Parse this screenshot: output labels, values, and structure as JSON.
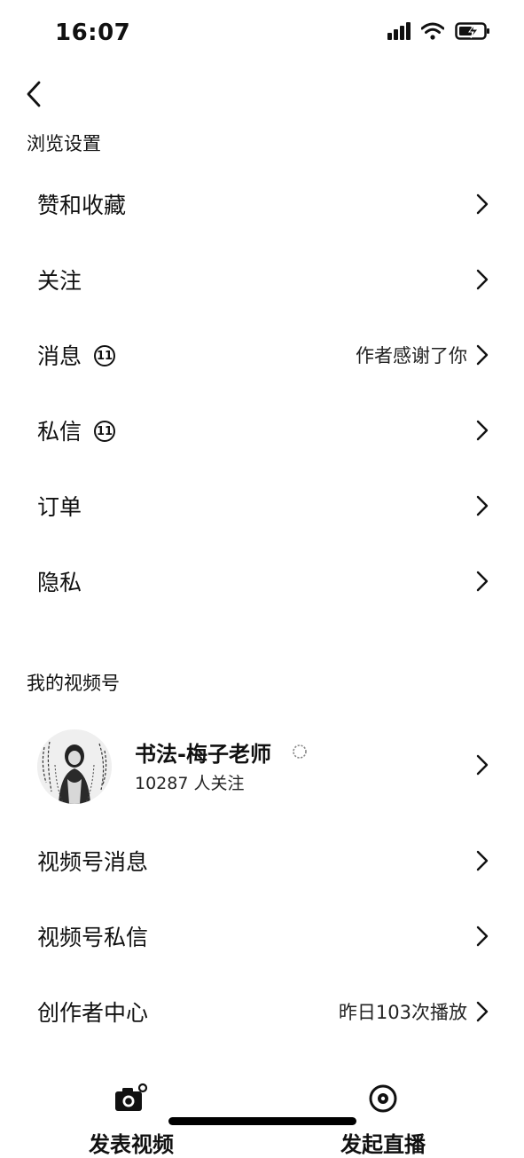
{
  "status_bar": {
    "time": "16:07"
  },
  "sections": {
    "browse_title": "浏览设置",
    "channel_title": "我的视频号"
  },
  "browse_items": [
    {
      "label": "赞和收藏",
      "right_text": "",
      "badge": ""
    },
    {
      "label": "关注",
      "right_text": "",
      "badge": ""
    },
    {
      "label": "消息",
      "right_text": "作者感谢了你",
      "badge": "11"
    },
    {
      "label": "私信",
      "right_text": "",
      "badge": "11"
    },
    {
      "label": "订单",
      "right_text": "",
      "badge": ""
    },
    {
      "label": "隐私",
      "right_text": "",
      "badge": ""
    }
  ],
  "profile": {
    "name": "书法-梅子老师",
    "followers": "10287 人关注"
  },
  "channel_items": [
    {
      "label": "视频号消息",
      "right_text": ""
    },
    {
      "label": "视频号私信",
      "right_text": ""
    },
    {
      "label": "创作者中心",
      "right_text": "昨日103次播放"
    }
  ],
  "bottom_bar": {
    "left_label": "发表视频",
    "right_label": "发起直播"
  },
  "icons": {
    "back": "chevron-left-icon",
    "row_arrow": "chevron-right-icon",
    "camera": "camera-icon",
    "live": "live-icon",
    "verify": "verify-icon"
  }
}
